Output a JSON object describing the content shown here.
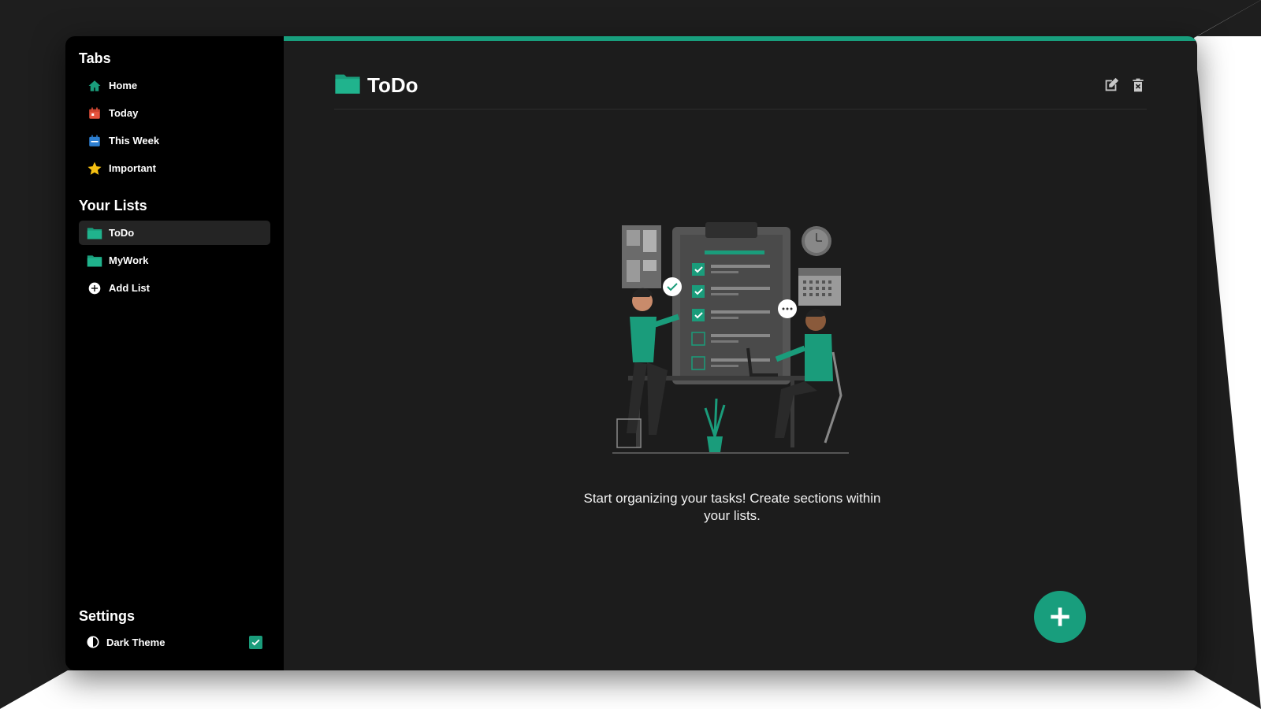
{
  "sidebar": {
    "tabs_title": "Tabs",
    "tabs": [
      {
        "label": "Home",
        "icon": "home-icon",
        "color": "#1a9c7b"
      },
      {
        "label": "Today",
        "icon": "calendar-today-icon",
        "color": "#e5533d"
      },
      {
        "label": "This Week",
        "icon": "calendar-week-icon",
        "color": "#2d7fd1"
      },
      {
        "label": "Important",
        "icon": "star-icon",
        "color": "#f5c012"
      }
    ],
    "lists_title": "Your Lists",
    "lists": [
      {
        "label": "ToDo",
        "icon": "folder-icon",
        "active": true
      },
      {
        "label": "MyWork",
        "icon": "folder-icon",
        "active": false
      }
    ],
    "add_list_label": "Add List",
    "settings_title": "Settings",
    "settings": [
      {
        "label": "Dark Theme",
        "icon": "contrast-icon",
        "checked": true
      }
    ]
  },
  "main": {
    "title": "ToDo",
    "title_icon": "folder-icon",
    "actions": [
      "edit-icon",
      "delete-icon"
    ],
    "empty_message": "Start organizing your tasks! Create sections within your lists.",
    "fab_icon": "plus-icon"
  },
  "colors": {
    "accent": "#189e7d",
    "sidebar_bg": "#000000",
    "main_bg": "#1c1c1c"
  }
}
